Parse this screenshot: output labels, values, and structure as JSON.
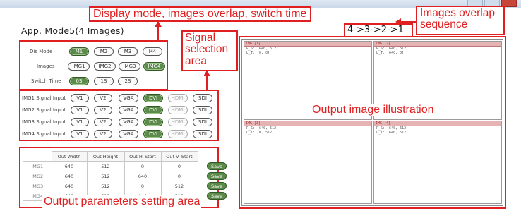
{
  "app": {
    "title": "App. Mode5(4 Images)"
  },
  "callouts": {
    "display_mode": "Display mode, images overlap, switch time",
    "signal_selection": "Signal selection area",
    "overlap_sequence": "Images overlap sequence",
    "sequence_value": "4->3->2->1",
    "output_illustration": "Output image illustration",
    "output_params": "Output parameters setting area"
  },
  "controls": {
    "dis_mode": {
      "label": "Dis Mode",
      "options": [
        "M1",
        "M2",
        "M3",
        "M4"
      ],
      "selected": "M1"
    },
    "images": {
      "label": "Images",
      "options": [
        "IMG1",
        "IMG2",
        "IMG3",
        "IMG4"
      ],
      "selected": "IMG4"
    },
    "switch_time": {
      "label": "Switch Time",
      "options": [
        "0S",
        "1S",
        "2S"
      ],
      "selected": "0S"
    }
  },
  "signals": {
    "options": [
      "V1",
      "V2",
      "VGA",
      "DVI",
      "HDMI",
      "SDI"
    ],
    "rows": [
      {
        "label": "IMG1 Signal Input",
        "selected": "DVI"
      },
      {
        "label": "IMG2 Signal Input",
        "selected": "DVI"
      },
      {
        "label": "IMG3 Signal Input",
        "selected": "DVI"
      },
      {
        "label": "IMG4 Signal Input",
        "selected": "DVI"
      }
    ],
    "disabled": "HDMI"
  },
  "params": {
    "headers": [
      "Out Width",
      "Out Height",
      "Out H_Start",
      "Out V_Start"
    ],
    "rows": [
      {
        "name": "IMG1",
        "values": [
          "640",
          "512",
          "0",
          "0"
        ],
        "save": "Save"
      },
      {
        "name": "IMG2",
        "values": [
          "640",
          "512",
          "640",
          "0"
        ],
        "save": "Save"
      },
      {
        "name": "IMG3",
        "values": [
          "640",
          "512",
          "0",
          "512"
        ],
        "save": "Save"
      },
      {
        "name": "IMG4",
        "values": [
          "640",
          "512",
          "640",
          "512"
        ],
        "save": "Save"
      }
    ]
  },
  "output": {
    "quads": [
      {
        "head": "IMG [1]",
        "l1": "P_S: [640, 512]",
        "l2": "L_T: [0, 0]"
      },
      {
        "head": "IMG [2]",
        "l1": "P_S: [640, 512]",
        "l2": "L_T: [640, 0]"
      },
      {
        "head": "IMG [3]",
        "l1": "P_S: [640, 512]",
        "l2": "L_T: [0, 512]"
      },
      {
        "head": "IMG [4]",
        "l1": "P_S: [640, 512]",
        "l2": "L_T: [640, 512]"
      }
    ]
  },
  "colors": {
    "accent_red": "#e02020",
    "selected_green": "#5c8a4a"
  }
}
